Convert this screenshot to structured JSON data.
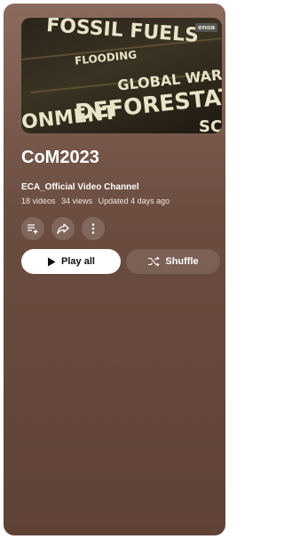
{
  "playlist": {
    "title": "CoM2023",
    "channel": "ECA_Official Video Channel",
    "video_count": "18 videos",
    "views": "34 views",
    "updated": "Updated 4 days ago"
  },
  "thumbnail": {
    "words": [
      "FOSSIL FUELS",
      "GLOBAL WARMING",
      "DEFORESTATION",
      "ONMENT",
      "FLOODING",
      "SCE",
      "enoa"
    ]
  },
  "actions": {
    "save_icon": "playlist-add-icon",
    "share_icon": "share-icon",
    "more_icon": "more-vert-icon"
  },
  "buttons": {
    "play_all": "Play all",
    "shuffle": "Shuffle"
  },
  "colors": {
    "panel_top": "#8a6b5e",
    "panel_bottom": "#5f4236",
    "play_bg": "#ffffff"
  }
}
